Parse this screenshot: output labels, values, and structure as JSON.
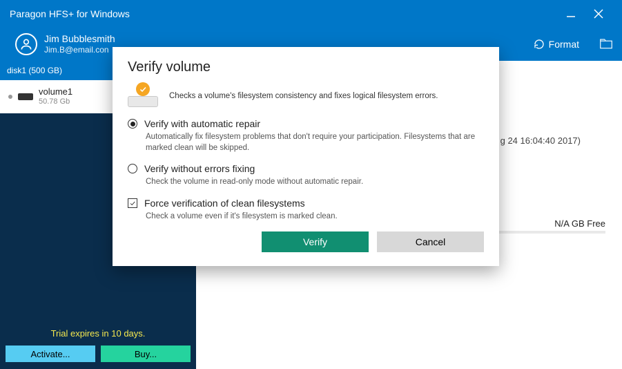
{
  "window": {
    "title": "Paragon HFS+ for Windows"
  },
  "user": {
    "name": "Jim Bubblesmith",
    "email": "Jim.B@email.con"
  },
  "header": {
    "format": "Format"
  },
  "sidebar": {
    "disk_label": "disk1 (500 GB)",
    "volume": {
      "name": "volume1",
      "size": "50.78 Gb"
    },
    "trial": "Trial expires in 10 days.",
    "activate": "Activate...",
    "buy": "Buy..."
  },
  "content": {
    "date_fragment": "g 24 16:04:40 2017)",
    "free": "N/A GB Free"
  },
  "modal": {
    "title": "Verify volume",
    "subtitle": "Checks a volume's filesystem consistency and fixes logical filesystem errors.",
    "opt1": {
      "label": "Verify with automatic repair",
      "sub": "Automatically fix filesystem problems that don't require your participation. Filesystems that are marked clean will be skipped.",
      "selected": true
    },
    "opt2": {
      "label": "Verify without errors fixing",
      "sub": "Check the volume in read-only mode without automatic repair.",
      "selected": false
    },
    "opt3": {
      "label": "Force verification of clean filesystems",
      "sub": "Check a volume even if it's filesystem is marked clean.",
      "checked": true
    },
    "verify_btn": "Verify",
    "cancel_btn": "Cancel"
  }
}
